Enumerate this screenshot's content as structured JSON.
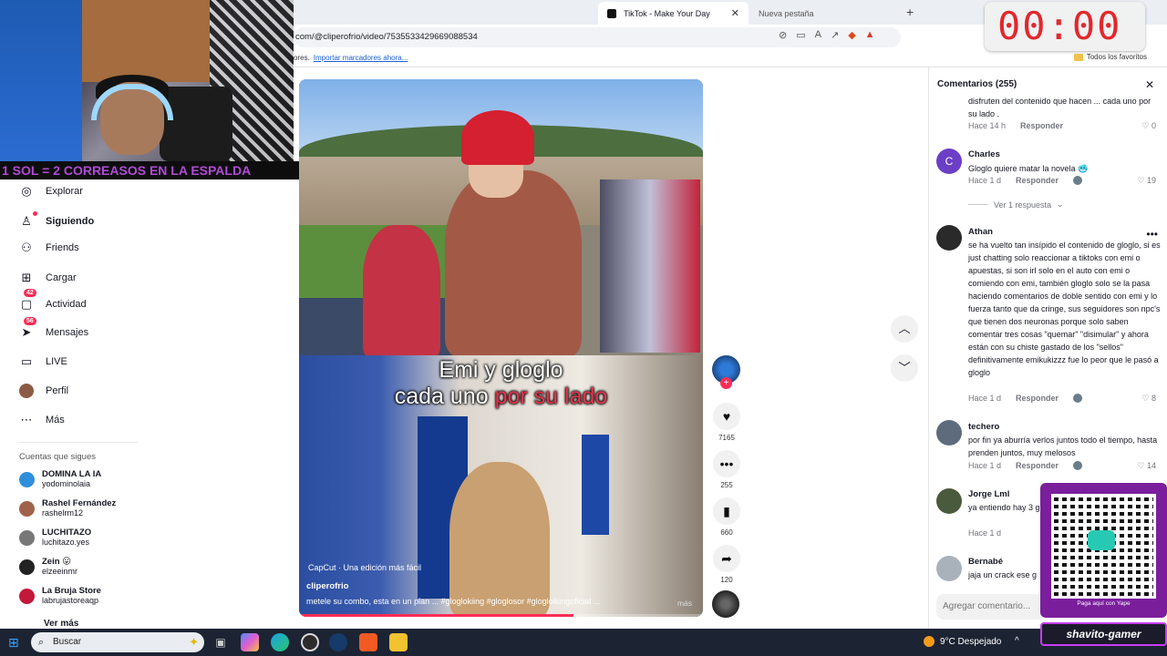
{
  "browser": {
    "active_tab": "TikTok - Make Your Day",
    "inactive_tab": "Nueva pestaña",
    "url": "com/@cliperofrio/video/7535533429669088534",
    "bookmarks_left": "ores.",
    "bookmarks_link": "Importar marcadores ahora...",
    "bookmarks_right": "Todos los favoritos"
  },
  "timer": "00:00",
  "overlay_banner": "1 SOL = 2 CORREASOS EN LA ESPALDA",
  "nav": {
    "items": [
      {
        "label": "Explorar",
        "icon": "compass-icon"
      },
      {
        "label": "Siguiendo",
        "icon": "user-follow-icon"
      },
      {
        "label": "Friends",
        "icon": "friends-icon"
      },
      {
        "label": "Cargar",
        "icon": "upload-icon"
      },
      {
        "label": "Actividad",
        "icon": "activity-icon",
        "badge": "42"
      },
      {
        "label": "Mensajes",
        "icon": "message-icon",
        "badge": "56"
      },
      {
        "label": "LIVE",
        "icon": "live-icon"
      },
      {
        "label": "Perfil",
        "icon": "profile-avatar"
      },
      {
        "label": "Más",
        "icon": "more-icon"
      }
    ],
    "following_title": "Cuentas que sigues",
    "accounts": [
      {
        "name": "DOMINA LA IA",
        "handle": "yodominolaia",
        "color": "#2f8fdc"
      },
      {
        "name": "Rashel Fernández",
        "handle": "rashelrm12",
        "color": "#a0624a"
      },
      {
        "name": "LUCHITAZO",
        "handle": "luchitazo.yes",
        "color": "#777777"
      },
      {
        "name": "Zein 😛",
        "handle": "elzeeinmr",
        "color": "#222222"
      },
      {
        "name": "La Bruja Store",
        "handle": "labrujastoreaqp",
        "color": "#c2183a"
      }
    ],
    "see_more": "Ver más"
  },
  "video": {
    "caption_line1": "Emi y gloglo",
    "caption_line2a": "cada uno ",
    "caption_line2b": "por su lado",
    "capcut": "CapCut · Una edición más fácil",
    "author": "cliperofrio",
    "description": "metele su combo, esta en un plan ... #gloglokiing #gloglosor #glogloikingoficial ...",
    "more": "más",
    "progress": 0.68
  },
  "actions": {
    "likes": "7165",
    "comments": "255",
    "saves": "660",
    "shares": "120"
  },
  "comments_panel": {
    "title": "Comentarios (255)",
    "c0_text": "disfruten del contenido que hacen ... cada uno por su lado .",
    "c0_time": "Hace 14 h",
    "c0_likes": "0",
    "c1_name": "Charles",
    "c1_initial": "C",
    "c1_text": "Gloglo quiere matar la novela 🥶",
    "c1_time": "Hace 1 d",
    "c1_likes": "19",
    "c1_replies": "Ver 1 respuesta",
    "c2_name": "Athan",
    "c2_text": "se ha vuelto tan insípido el contenido de gloglo, si es just chatting solo reaccionar a tiktoks con emi o apuestas, si son irl solo en el auto con emi o comiendo con emi, también gloglo solo se la pasa haciendo comentarios de doble sentido con emi y lo fuerza tanto que da cringe, sus seguidores son npc's que tienen dos neuronas porque solo saben comentar tres cosas \"quemar\" \"disimular\" y ahora están con su chiste gastado de los \"sellos\" definitivamente emikukizzz fue lo peor que le pasó a gloglo",
    "c2_time": "Hace 1 d",
    "c2_likes": "8",
    "c3_name": "techero",
    "c3_text": "por fin ya aburría verlos juntos todo el tiempo, hasta prenden juntos, muy melosos",
    "c3_time": "Hace 1 d",
    "c3_likes": "14",
    "c4_name": "Jorge Lml",
    "c4_text": "ya entiendo hay 3 grupo loco sylve y",
    "c4_time": "Hace 1 d",
    "c5_name": "Bernabé",
    "c5_text": "jaja un crack ese g",
    "reply_label": "Responder",
    "input_placeholder": "Agregar comentario..."
  },
  "qr": {
    "brand": "yape",
    "subtitle": "Paga aquí con Yape"
  },
  "streamer_tag": "shavito-gamer",
  "taskbar": {
    "search": "Buscar",
    "weather": "9°C  Despejado"
  },
  "colors": {
    "accent": "#fe2c55",
    "banner_text": "#b14bd6",
    "timer": "#e1282d",
    "qr_bg": "#7a1e9c"
  }
}
